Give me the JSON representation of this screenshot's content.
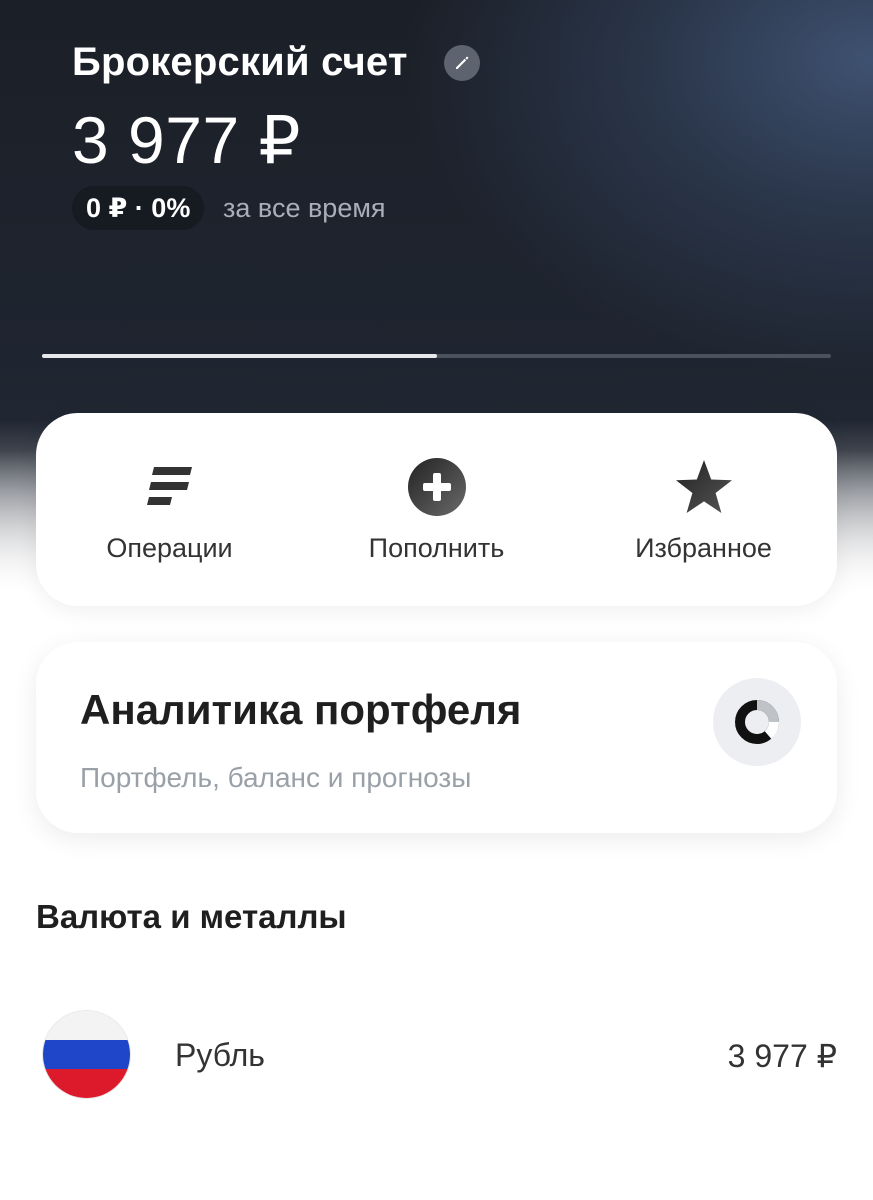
{
  "header": {
    "account_title": "Брокерский счет",
    "balance": "3 977 ₽",
    "pnl": "0 ₽ · 0%",
    "pnl_period": "за все время",
    "carousel_progress": 0.5
  },
  "actions": [
    {
      "label": "Операции",
      "icon": "operations-icon"
    },
    {
      "label": "Пополнить",
      "icon": "plus-circle-icon"
    },
    {
      "label": "Избранное",
      "icon": "star-icon"
    }
  ],
  "analytics": {
    "title": "Аналитика портфеля",
    "subtitle": "Портфель, баланс и прогнозы",
    "icon": "donut-chart-icon"
  },
  "currencies": {
    "section_title": "Валюта и металлы",
    "items": [
      {
        "name": "Рубль",
        "amount": "3 977 ₽",
        "icon": "russia-flag-icon"
      }
    ]
  },
  "colors": {
    "hero_dark": "#1b1f27",
    "hero_accent": "#405474",
    "text_primary": "#1f1f1f",
    "text_secondary": "#9aa0a8"
  }
}
